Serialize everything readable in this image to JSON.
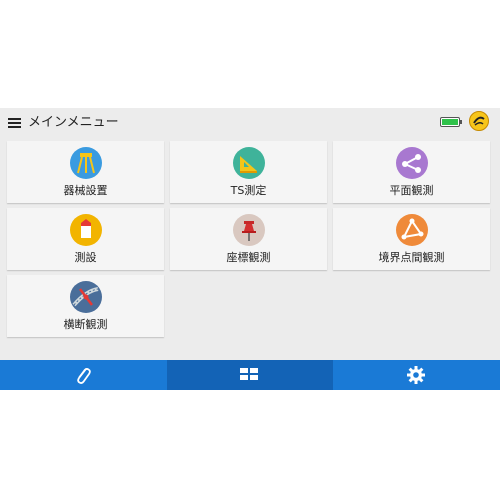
{
  "header": {
    "title": "メインメニュー",
    "battery_level": 1.0,
    "menu_icon": "hamburger-icon",
    "logo_icon": "app-logo-icon"
  },
  "tiles": [
    {
      "label": "器械設置",
      "icon": "tripod-icon",
      "icon_color": "#3a9be0"
    },
    {
      "label": "TS測定",
      "icon": "triangle-ruler-icon",
      "icon_color": "#3fb39a"
    },
    {
      "label": "平面観測",
      "icon": "connected-nodes-icon",
      "icon_color": "#a878d0"
    },
    {
      "label": "測設",
      "icon": "stake-marker-icon",
      "icon_color": "#f2b400"
    },
    {
      "label": "座標観測",
      "icon": "pushpin-icon",
      "icon_color": "#d9c8c0"
    },
    {
      "label": "境界点間観測",
      "icon": "boundary-triangle-icon",
      "icon_color": "#ef8a3a"
    },
    {
      "label": "横断観測",
      "icon": "road-cross-icon",
      "icon_color": "#4a6e9a"
    }
  ],
  "bottom_nav": [
    {
      "icon": "paperclip-icon",
      "active": false
    },
    {
      "icon": "grid-menu-icon",
      "active": true
    },
    {
      "icon": "gear-icon",
      "active": false
    }
  ],
  "colors": {
    "nav_bar": "#1a7ad6",
    "nav_active": "#1363b6",
    "battery_fill": "#2fc24a"
  }
}
